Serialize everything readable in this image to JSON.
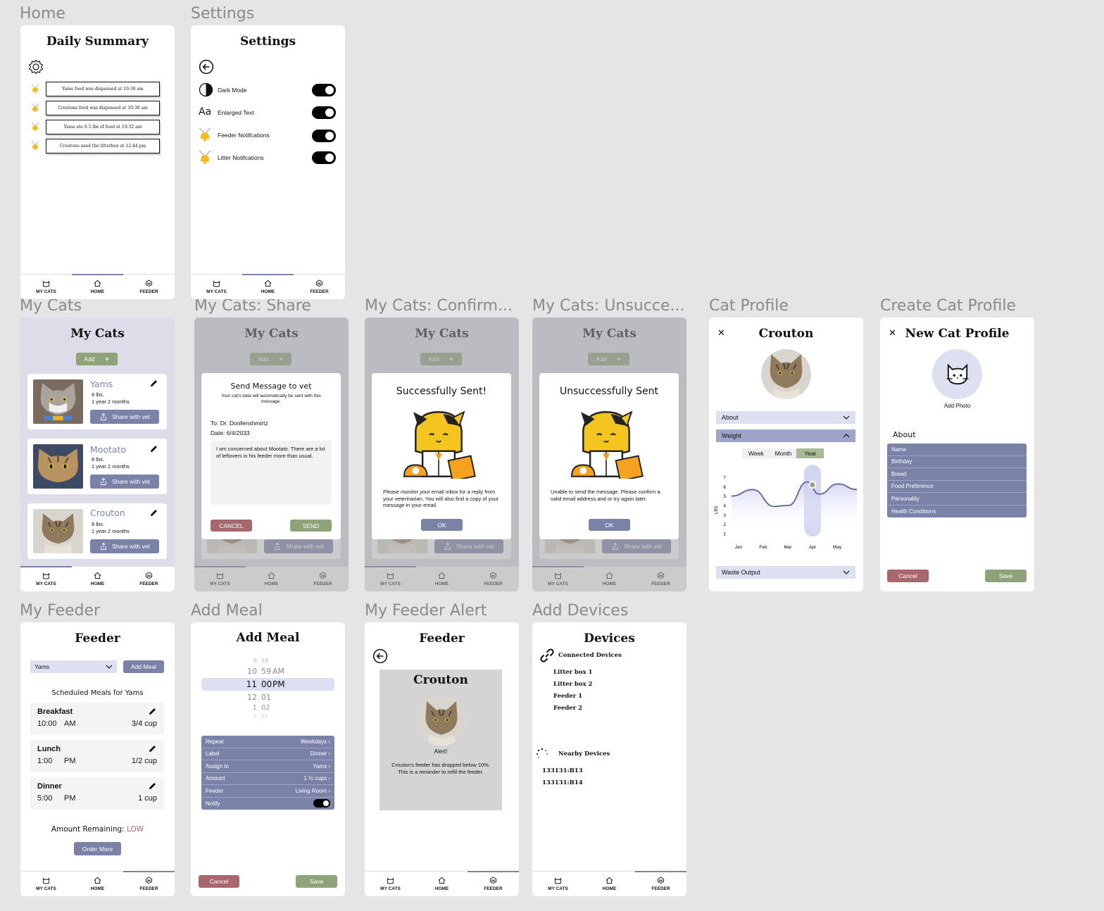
{
  "frame_labels": {
    "home": "Home",
    "settings": "Settings",
    "mycats": "My Cats",
    "share": "My Cats: Share",
    "confirm": "My Cats: Confirm...",
    "unsucc": "My Cats: Unsucce...",
    "profile": "Cat Profile",
    "create": "Create Cat Profile",
    "feeder": "My Feeder",
    "addmeal": "Add Meal",
    "alert": "My Feeder Alert",
    "devices": "Add Devices"
  },
  "nav": {
    "mycats": "MY CATS",
    "home": "HOME",
    "feeder": "FEEDER"
  },
  "home": {
    "title": "Daily Summary",
    "events": [
      "Yams food was dispensed at 10:30 am",
      "Croutons food was dispensed at 10:30 am",
      "Yams ate 0.5 lbs of food at 10:32 am",
      "Croutons used the litterbox at 12:44 pm"
    ]
  },
  "settings": {
    "title": "Settings",
    "aa_glyph": "Aa",
    "items": [
      "Dark Mode",
      "Enlarged Text",
      "Feeder Notifcations",
      "Litter Notifcations"
    ]
  },
  "mycats": {
    "title": "My Cats",
    "add": "Add",
    "plus": "+",
    "share": "Share with vet",
    "cats": [
      {
        "name": "Yams",
        "weight": "8 lbs.",
        "age": "1 year 2 months"
      },
      {
        "name": "Mootato",
        "weight": "8 lbs.",
        "age": "1 year 2 months"
      },
      {
        "name": "Crouton",
        "weight": "8 lbs.",
        "age": "1 year 2 months"
      }
    ]
  },
  "share": {
    "title": "Send Message to vet",
    "subtitle": "Your cat's data will automatically be sent with this message.",
    "to": "To: Dr. Doofenshmirtz",
    "date": "Date: 6/4/2033",
    "message": "I am concerned about Mootato. There are a lot of leftovers in his feeder more than usual.",
    "cancel": "CANCEL",
    "send": "SEND"
  },
  "confirm": {
    "title": "Successfully Sent!",
    "body": "Please monitor your email inbox for a reply from your veterinarian. You will also find a copy of your message in your email.",
    "ok": "OK"
  },
  "unsucc": {
    "title": "Unsuccessfully Sent",
    "body": "Unable to send the message. Please confirm a valid email address and or try again later.",
    "ok": "OK"
  },
  "profile": {
    "title": "Crouton",
    "about": "About",
    "weight": "Weight",
    "waste": "Waste Output",
    "tabs": [
      "Week",
      "Month",
      "Year"
    ]
  },
  "chart_data": {
    "type": "line",
    "categories": [
      "Jan",
      "Feb",
      "Mar",
      "Apr",
      "May"
    ],
    "ylabel": "LBS",
    "ylim": [
      1,
      7
    ],
    "yticks": [
      1,
      2,
      3,
      4,
      5,
      6,
      7
    ],
    "points": [
      [
        0.5,
        5.0
      ],
      [
        1.4,
        5.7
      ],
      [
        2.3,
        3.9
      ],
      [
        2.9,
        4.0
      ],
      [
        3.7,
        6.5
      ],
      [
        4.2,
        5.2
      ],
      [
        5.0,
        6.3
      ],
      [
        5.8,
        5.7
      ]
    ],
    "highlight": "Apr",
    "line_color": "#6a7099"
  },
  "create": {
    "title": "New Cat Profile",
    "add_photo": "Add Photo",
    "about": "About",
    "fields": [
      "Name",
      "Birthday",
      "Breed",
      "Food Preference",
      "Personality",
      "Health Conditions"
    ],
    "cancel": "Cancel",
    "save": "Save"
  },
  "feeder": {
    "title": "Feeder",
    "select": "Yams",
    "addmeal": "Add Meal",
    "scheduled": "Scheduled Meals for Yams",
    "meals": [
      {
        "name": "Breakfast",
        "time": "10:00",
        "ampm": "AM",
        "amount": "3/4 cup"
      },
      {
        "name": "Lunch",
        "time": "1:00",
        "ampm": "PM",
        "amount": "1/2 cup"
      },
      {
        "name": "Dinner",
        "time": "5:00",
        "ampm": "PM",
        "amount": "1 cup"
      }
    ],
    "remaining_label": "Amount Remaining:",
    "remaining_value": "LOW",
    "order": "Order More"
  },
  "addmeal": {
    "title": "Add Meal",
    "picker_rows": [
      {
        "h": "9",
        "m": "58",
        "ap": ""
      },
      {
        "h": "10",
        "m": "59",
        "ap": "AM"
      },
      {
        "h": "11",
        "m": "00",
        "ap": "PM"
      },
      {
        "h": "12",
        "m": "01",
        "ap": ""
      },
      {
        "h": "1",
        "m": "02",
        "ap": ""
      },
      {
        "h": "2",
        "m": "03",
        "ap": ""
      }
    ],
    "options": [
      {
        "label": "Repeat",
        "value": "Weekdays"
      },
      {
        "label": "Label",
        "value": "Dinner"
      },
      {
        "label": "Assign to",
        "value": "Yams"
      },
      {
        "label": "Amount",
        "value": "1 ½ cups"
      },
      {
        "label": "Feeder",
        "value": "Living Room"
      },
      {
        "label": "Notify",
        "value": ""
      }
    ],
    "cancel": "Cancel",
    "save": "Save"
  },
  "alert": {
    "title": "Feeder",
    "cat": "Crouton",
    "alert": "Alert!",
    "body": "Crouton's feeder has dropped below 10%. This is a reminder to refill the feeder."
  },
  "devices": {
    "title": "Devices",
    "connected": "Connected Devices",
    "items": [
      "Litter box 1",
      "Litter box 2",
      "Feeder 1",
      "Feeder 2"
    ],
    "nearby": "Nearby Devices",
    "nearby_items": [
      "133131:B13",
      "133131:B14"
    ]
  },
  "colors": {
    "accent": "#7b82a8",
    "green": "#8fa37a",
    "red": "#a8676c",
    "lavender": "#dde0f0"
  }
}
